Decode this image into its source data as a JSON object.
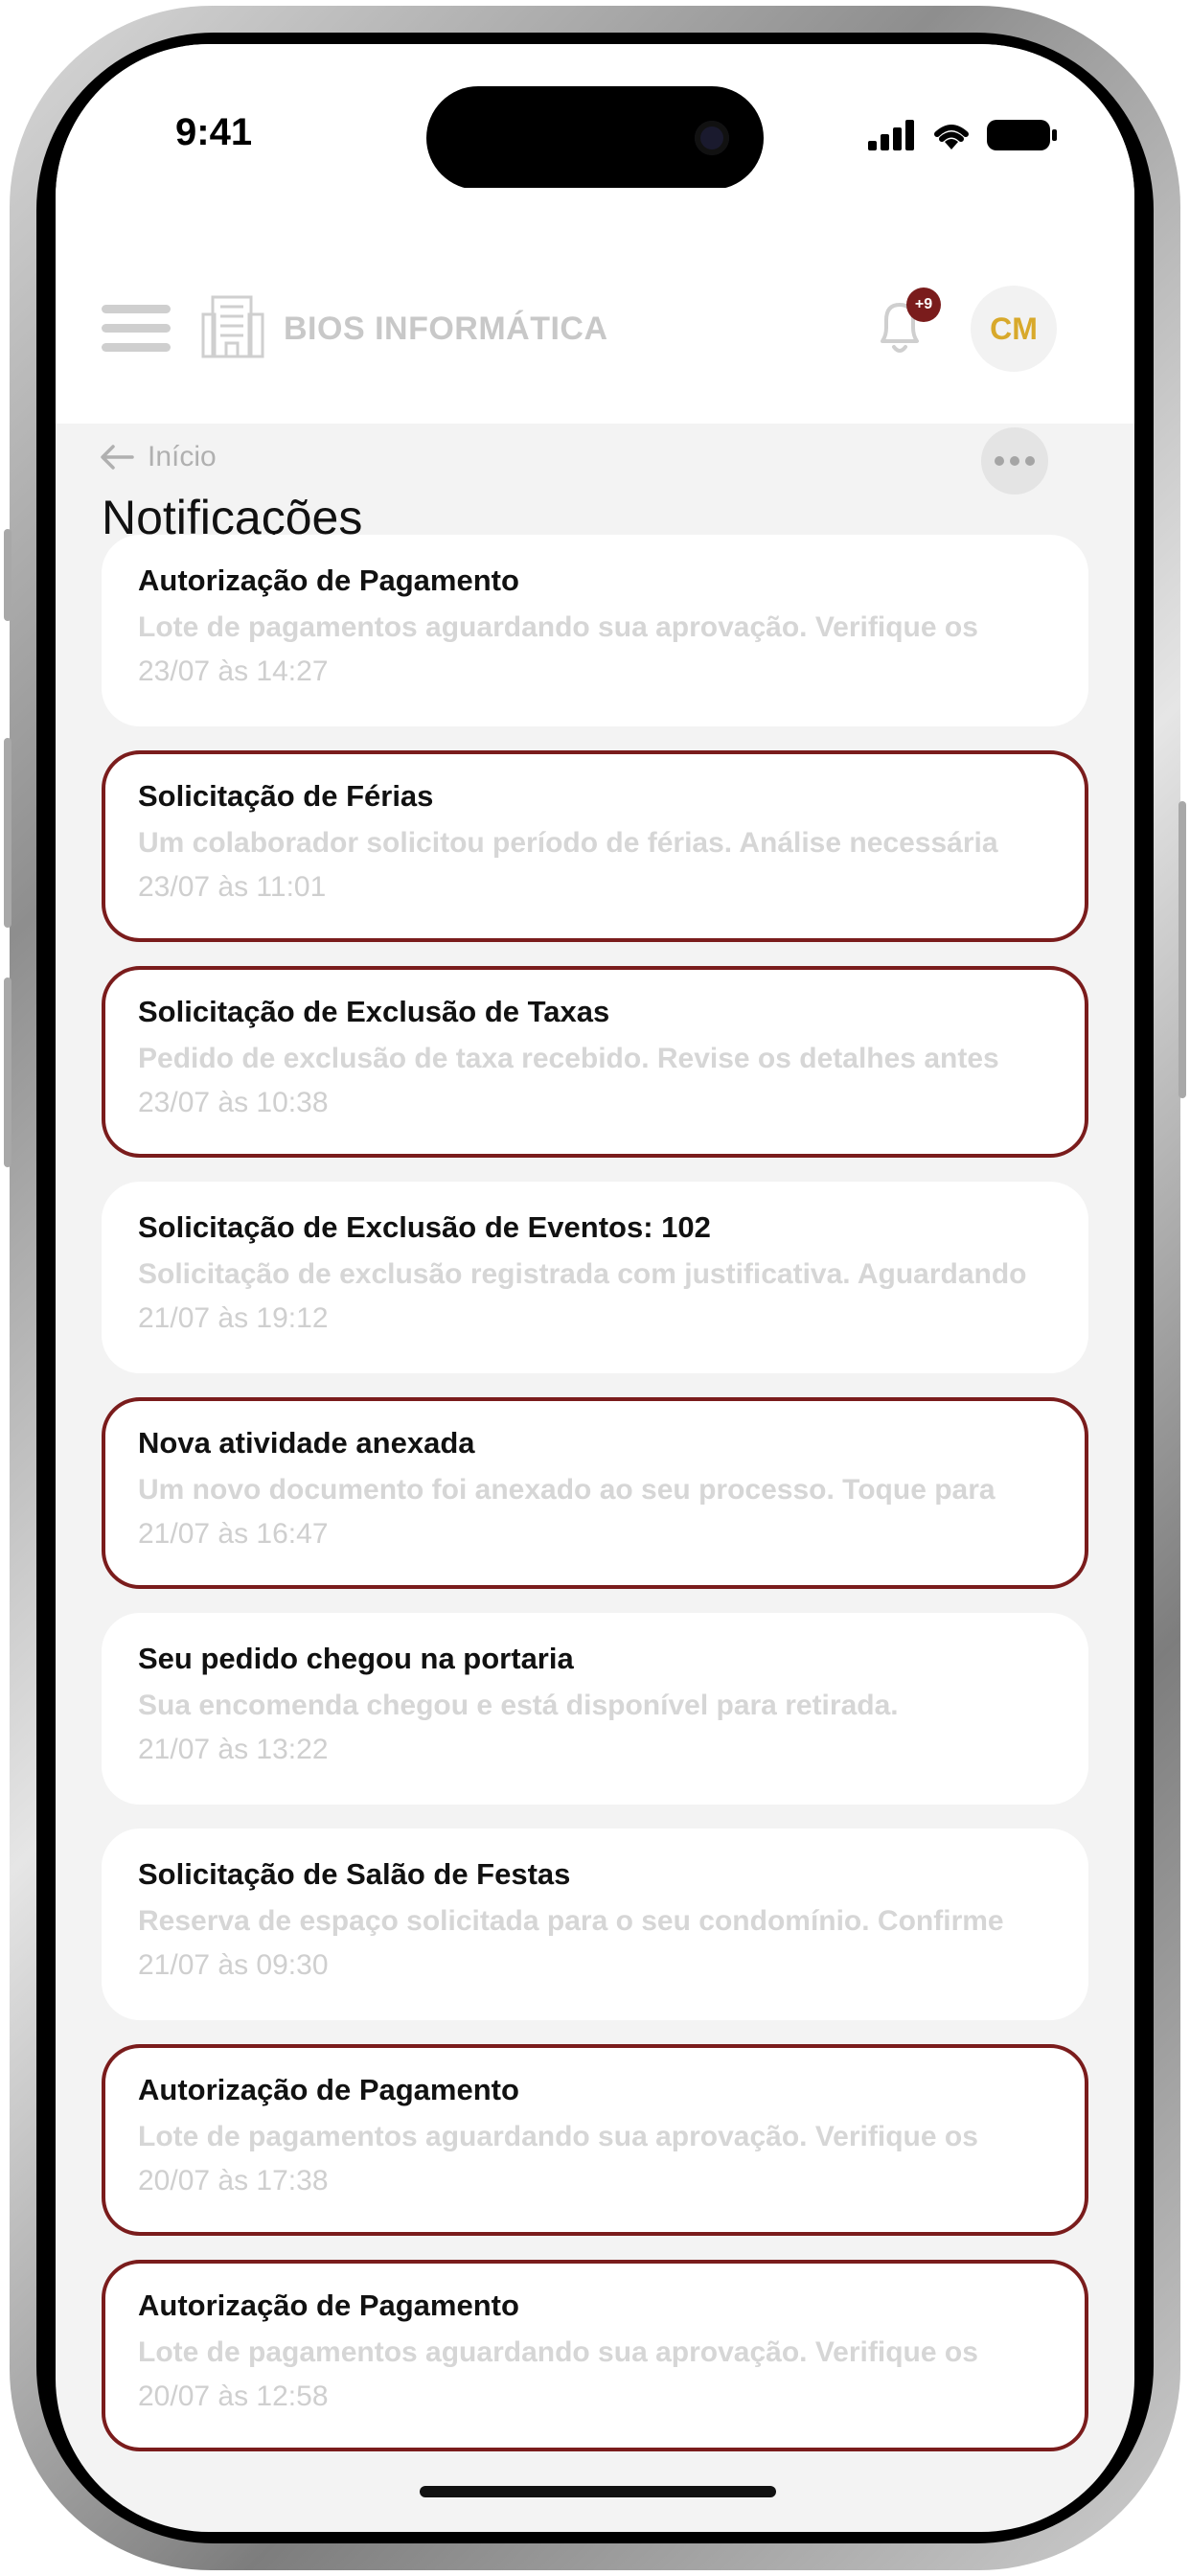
{
  "status_bar": {
    "time": "9:41"
  },
  "header": {
    "brand": "BIOS INFORMÁTICA",
    "notification_badge": "+9",
    "avatar_initials": "CM"
  },
  "breadcrumb": {
    "back_label": "Início"
  },
  "page": {
    "title": "Notificações"
  },
  "colors": {
    "accent": "#7a1c1c",
    "avatar_text": "#d8a92b"
  },
  "notifications": [
    {
      "title": "Autorização de Pagamento",
      "body": "Lote de pagamentos aguardando sua aprovação. Verifique os",
      "time": "23/07 às 14:27",
      "unread": false
    },
    {
      "title": "Solicitação de Férias",
      "body": "Um colaborador solicitou período de férias. Análise necessária",
      "time": "23/07 às 11:01",
      "unread": true
    },
    {
      "title": "Solicitação de Exclusão de Taxas",
      "body": "Pedido de exclusão de taxa recebido. Revise os detalhes antes",
      "time": "23/07 às 10:38",
      "unread": true
    },
    {
      "title": "Solicitação de Exclusão de Eventos: 102",
      "body": "Solicitação de exclusão registrada com justificativa. Aguardando",
      "time": "21/07 às 19:12",
      "unread": false
    },
    {
      "title": "Nova atividade anexada",
      "body": "Um novo documento foi anexado ao seu processo. Toque para",
      "time": "21/07 às 16:47",
      "unread": true
    },
    {
      "title": "Seu pedido chegou na portaria",
      "body": "Sua encomenda chegou e está disponível para retirada.",
      "time": "21/07 às 13:22",
      "unread": false
    },
    {
      "title": "Solicitação de Salão de Festas",
      "body": "Reserva de espaço solicitada para o seu condomínio. Confirme",
      "time": "21/07 às 09:30",
      "unread": false
    },
    {
      "title": "Autorização de Pagamento",
      "body": "Lote de pagamentos aguardando sua aprovação. Verifique os",
      "time": "20/07 às 17:38",
      "unread": true
    },
    {
      "title": "Autorização de Pagamento",
      "body": "Lote de pagamentos aguardando sua aprovação. Verifique os",
      "time": "20/07 às 12:58",
      "unread": true
    }
  ]
}
